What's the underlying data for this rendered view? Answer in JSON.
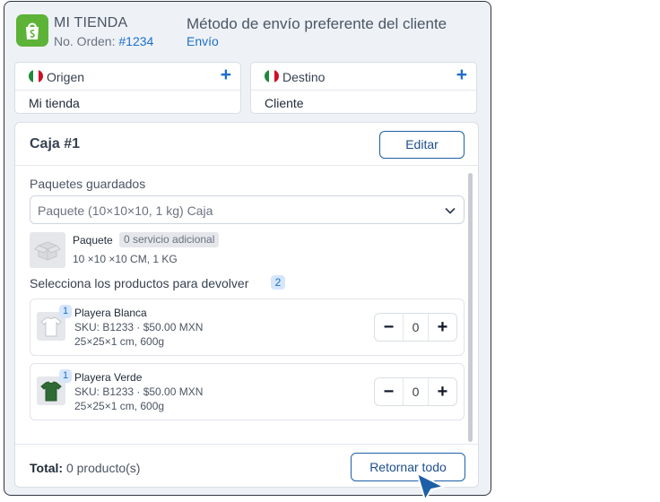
{
  "header": {
    "store_name": "MI TIENDA",
    "order_label": "No. Orden:",
    "order_number": "#1234",
    "method_title": "Método de envío preferente del cliente",
    "method_subtitle": "Envío"
  },
  "origin": {
    "title": "Origen",
    "value": "Mi tienda"
  },
  "destination": {
    "title": "Destino",
    "value": "Cliente"
  },
  "box": {
    "title": "Caja #1",
    "edit_label": "Editar",
    "saved_packages_label": "Paquetes guardados",
    "selected_package": "Paquete (10×10×10, 1 kg) Caja",
    "package_name": "Paquete",
    "package_badge": "0 servicio adicional",
    "package_dims": "10 ×10 ×10 CM, 1 KG",
    "select_products_label": "Selecciona los productos para devolver",
    "select_products_count": "2",
    "items": [
      {
        "qty_badge": "1",
        "name": "Playera Blanca",
        "sku": "SKU: B1233 · $50.00 MXN",
        "dims": "25×25×1 cm, 600g",
        "quantity": "0",
        "color": "#d1d5db"
      },
      {
        "qty_badge": "1",
        "name": "Playera Verde",
        "sku": "SKU: B1233 · $50.00 MXN",
        "dims": "25×25×1 cm, 600g",
        "quantity": "0",
        "color": "#2e6b34"
      }
    ],
    "total_label": "Total:",
    "total_value": "0 producto(s)",
    "return_all_label": "Retornar todo"
  },
  "colors": {
    "accent": "#1d6fc9",
    "brand_green": "#5cb338",
    "flag_green": "#1f8a3c",
    "flag_red": "#ce1126"
  },
  "icons": [
    "shopify-bag-icon",
    "mexico-flag-icon",
    "plus-icon",
    "chevron-down-icon",
    "package-box-icon",
    "minus-icon",
    "mouse-cursor-icon"
  ]
}
